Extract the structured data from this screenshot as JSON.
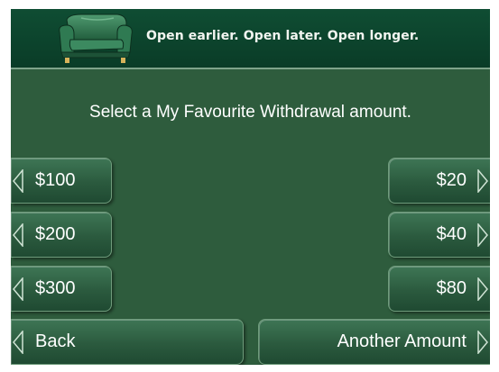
{
  "banner": {
    "slogan": "Open earlier. Open later. Open longer."
  },
  "prompt": "Select a My Favourite Withdrawal amount.",
  "left_buttons": [
    {
      "label": "$100"
    },
    {
      "label": "$200"
    },
    {
      "label": "$300"
    },
    {
      "label": "Back"
    }
  ],
  "right_buttons": [
    {
      "label": "$20"
    },
    {
      "label": "$40"
    },
    {
      "label": "$80"
    },
    {
      "label": "Another Amount"
    }
  ],
  "icons": {
    "banner": "armchair-icon",
    "left_button": "left-arrow-icon",
    "right_button": "right-arrow-icon"
  },
  "colors": {
    "screen_background": "#2e5c3d",
    "banner_background": "#0a3c27",
    "text": "#ffffff"
  }
}
